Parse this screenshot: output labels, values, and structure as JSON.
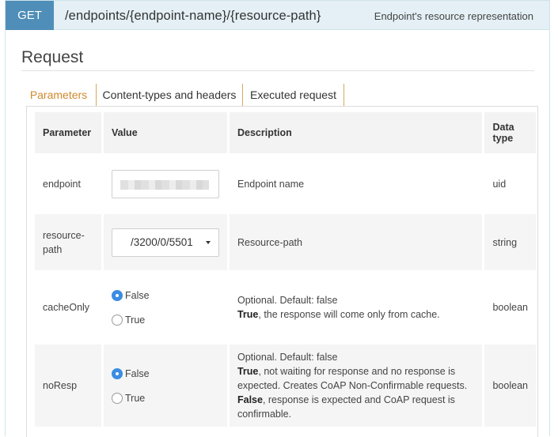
{
  "operation": {
    "method": "GET",
    "path": "/endpoints/{endpoint-name}/{resource-path}",
    "summary": "Endpoint's resource representation"
  },
  "request": {
    "title": "Request",
    "tabs": [
      {
        "label": "Parameters",
        "active": true
      },
      {
        "label": "Content-types and headers",
        "active": false
      },
      {
        "label": "Executed request",
        "active": false
      }
    ],
    "columns": {
      "parameter": "Parameter",
      "value": "Value",
      "description": "Description",
      "type_line1": "Data",
      "type_line2": "type"
    },
    "params": {
      "endpoint": {
        "name": "endpoint",
        "value_blurred": true,
        "description": "Endpoint name",
        "type": "uid"
      },
      "resource_path": {
        "name_line1": "resource-",
        "name_line2": "path",
        "selected_value": "/3200/0/5501",
        "description": "Resource-path",
        "type": "string"
      },
      "cacheOnly": {
        "name": "cacheOnly",
        "options": [
          {
            "label": "False",
            "checked": true
          },
          {
            "label": "True",
            "checked": false
          }
        ],
        "desc_line1": "Optional. Default: false",
        "desc_bold": "True",
        "desc_rest": ", the response will come only from cache.",
        "type": "boolean"
      },
      "noResp": {
        "name": "noResp",
        "options": [
          {
            "label": "False",
            "checked": true
          },
          {
            "label": "True",
            "checked": false
          }
        ],
        "desc_line1": "Optional. Default: false",
        "desc_bold1": "True",
        "desc_rest1": ", not waiting for response and no response is expected. Creates CoAP Non-Confirmable requests.",
        "desc_bold2": "False",
        "desc_rest2": ", response is expected and CoAP request is confirmable.",
        "type": "boolean"
      }
    }
  },
  "colors": {
    "method_bg": "#4f8eb8",
    "header_bg": "#e4f0f5",
    "active_tab": "#d08a2c",
    "radio_checked": "#3b8de2"
  }
}
